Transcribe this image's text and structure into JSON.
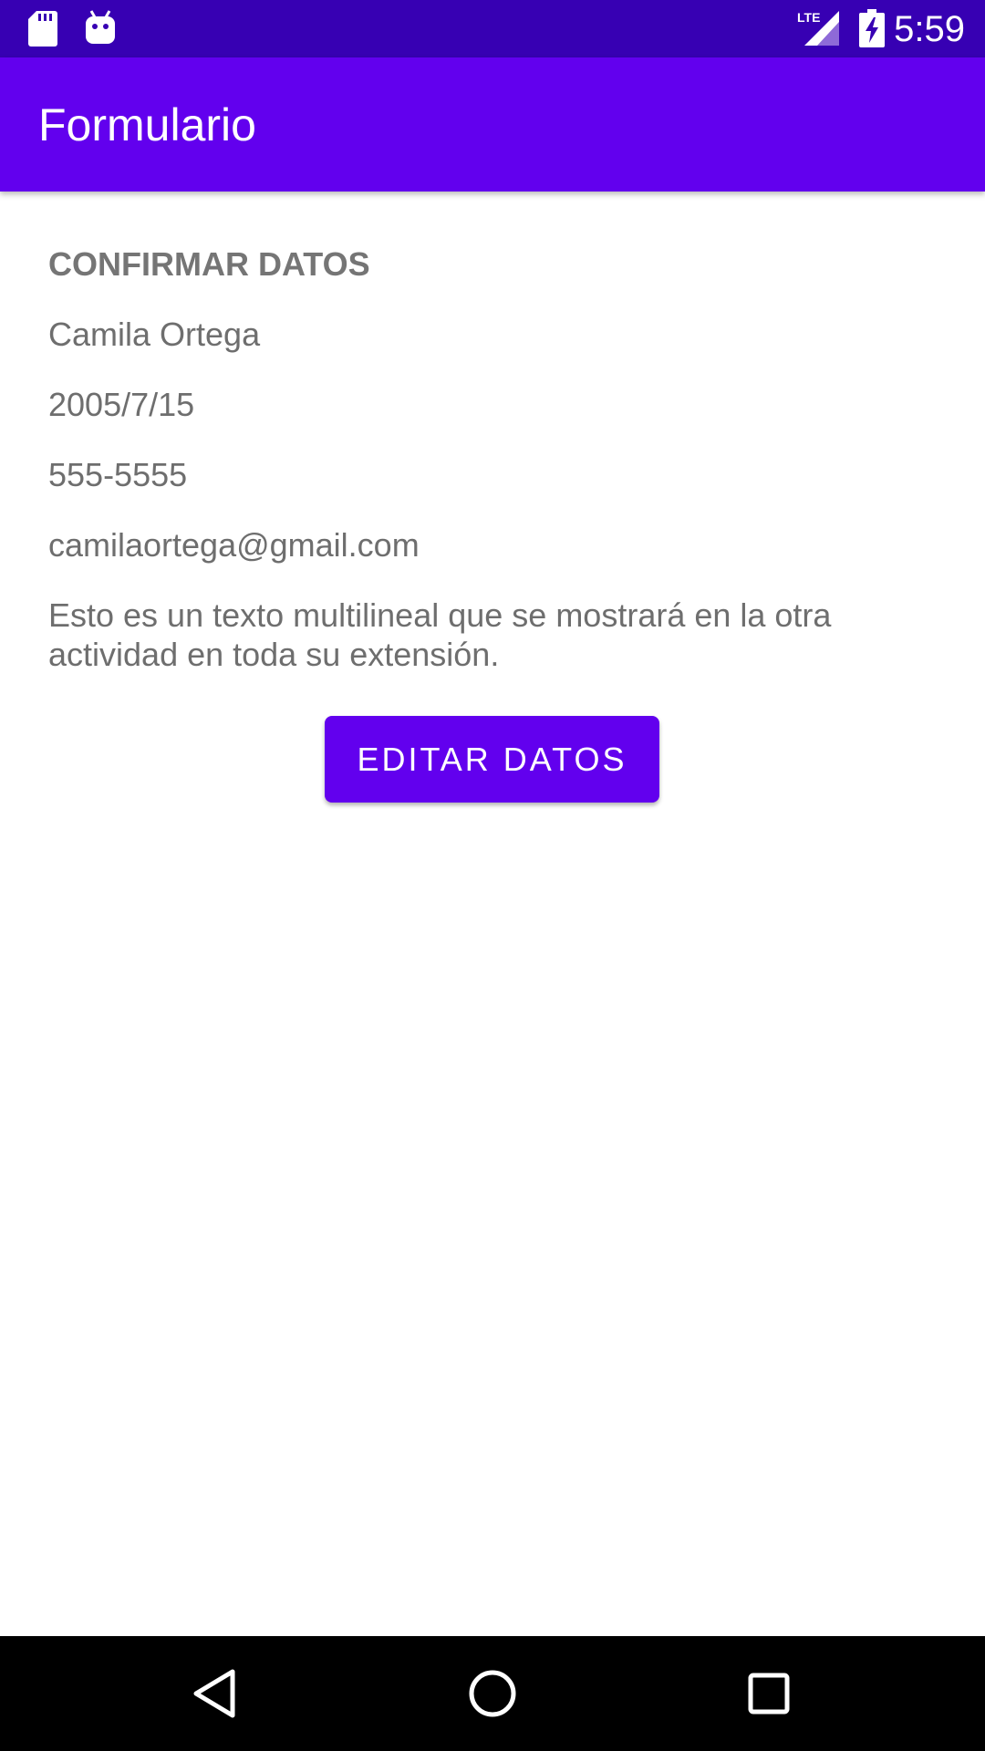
{
  "status_bar": {
    "time": "5:59",
    "left_icons": [
      "sd-card-icon",
      "android-debug-icon"
    ],
    "right_icons": [
      "lte-signal-icon",
      "battery-charging-icon"
    ],
    "network_label": "LTE"
  },
  "app_bar": {
    "title": "Formulario"
  },
  "confirm": {
    "heading": "CONFIRMAR DATOS",
    "name": "Camila Ortega",
    "date": "2005/7/15",
    "phone": "555-5555",
    "email": "camilaortega@gmail.com",
    "description": "Esto es un texto multilineal que se mostrará en la otra actividad en toda su extensión."
  },
  "actions": {
    "edit_label": "EDITAR DATOS"
  },
  "nav_bar": {
    "buttons": [
      "back-icon",
      "home-icon",
      "recents-icon"
    ]
  },
  "colors": {
    "status_bar": "#3700B3",
    "primary": "#6200EE",
    "text_secondary": "#6e6e6e",
    "nav_bar": "#000000"
  }
}
